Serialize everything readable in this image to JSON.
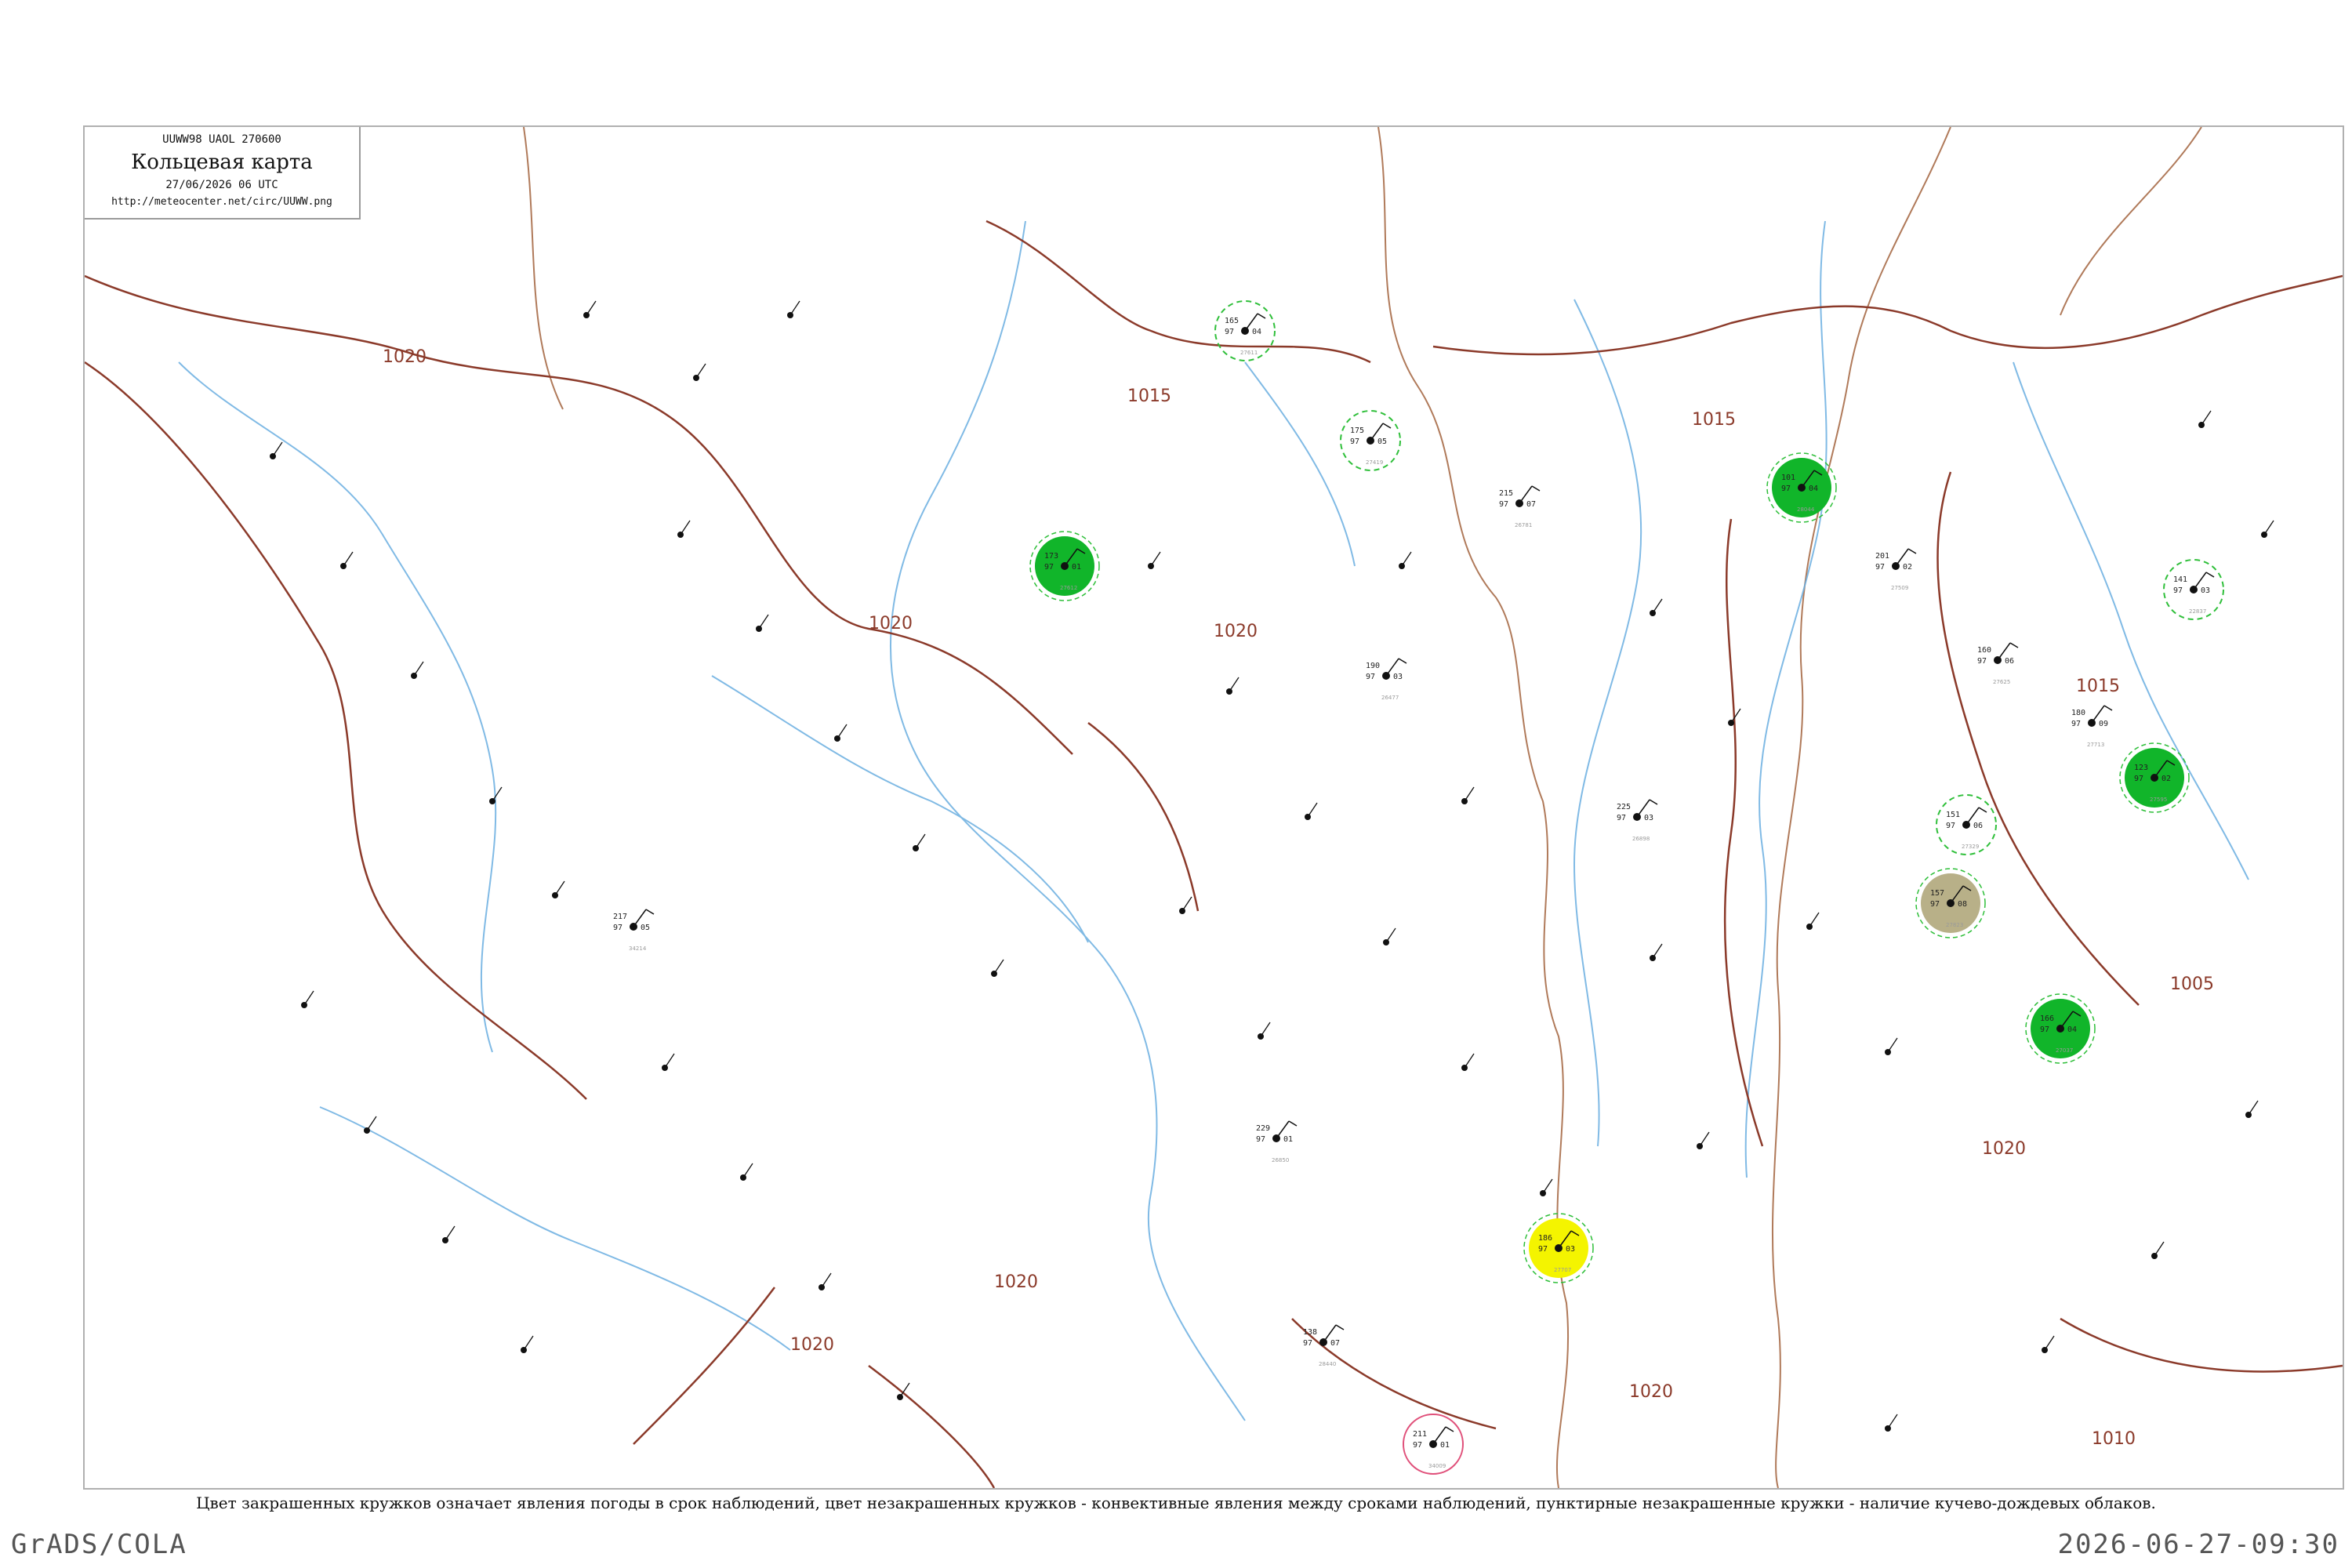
{
  "header": {
    "code": "UUWW98 UAOL 270600",
    "title": "Кольцевая карта",
    "datetime": "27/06/2026 06 UTC",
    "url": "http://meteocenter.net/circ/UUWW.png"
  },
  "caption": "Цвет закрашенных кружков означает явления погоды в срок наблюдений, цвет незакрашенных кружков - конвективные явления между сроками наблюдений, пунктирные незакрашенные кружки - наличие кучево-дождевых облаков.",
  "footer": {
    "software": "GrADS/COLA",
    "timestamp": "2026-06-27-09:30"
  },
  "colors": {
    "isobar": "#8b3a2a",
    "river": "#6aaee0",
    "rain_fill": "#11b52a",
    "cb_ring": "#2fbf3a",
    "fog_fill": "#f4f400",
    "haze_fill": "#b8b088",
    "shower_fill": "#5fe0c8",
    "thunder_ring": "#e0507a"
  },
  "isobar_labels": [
    "1020",
    "1015",
    "1010",
    "1005"
  ],
  "stations": [
    {
      "id": "27612",
      "top": "173",
      "temp": "97",
      "pres": "01",
      "wx": "rain"
    },
    {
      "id": "27611",
      "top": "165",
      "temp": "97",
      "pres": "04",
      "wx": "cb"
    },
    {
      "id": "27625",
      "top": "160",
      "temp": "97",
      "pres": "06",
      "wx": "none"
    },
    {
      "id": "26898",
      "top": "225",
      "temp": "97",
      "pres": "03",
      "wx": "none"
    },
    {
      "id": "27509",
      "top": "201",
      "temp": "97",
      "pres": "02",
      "wx": "none"
    },
    {
      "id": "27713",
      "top": "180",
      "temp": "97",
      "pres": "09",
      "wx": "none"
    },
    {
      "id": "26781",
      "top": "215",
      "temp": "97",
      "pres": "07",
      "wx": "none"
    },
    {
      "id": "27419",
      "top": "175",
      "temp": "97",
      "pres": "05",
      "wx": "cb"
    },
    {
      "id": "27707",
      "top": "186",
      "temp": "97",
      "pres": "03",
      "wx": "fog"
    },
    {
      "id": "27823",
      "top": "157",
      "temp": "97",
      "pres": "08",
      "wx": "haze"
    },
    {
      "id": "28044",
      "top": "101",
      "temp": "97",
      "pres": "04",
      "wx": "rain"
    },
    {
      "id": "22837",
      "top": "141",
      "temp": "97",
      "pres": "03",
      "wx": "cb"
    },
    {
      "id": "26477",
      "top": "190",
      "temp": "97",
      "pres": "03",
      "wx": "none"
    },
    {
      "id": "27037",
      "top": "166",
      "temp": "97",
      "pres": "04",
      "wx": "rain"
    },
    {
      "id": "26850",
      "top": "229",
      "temp": "97",
      "pres": "01",
      "wx": "none"
    },
    {
      "id": "27329",
      "top": "151",
      "temp": "97",
      "pres": "06",
      "wx": "cb"
    },
    {
      "id": "27595",
      "top": "123",
      "temp": "97",
      "pres": "02",
      "wx": "rain"
    },
    {
      "id": "28440",
      "top": "138",
      "temp": "97",
      "pres": "07",
      "wx": "none"
    },
    {
      "id": "34214",
      "top": "217",
      "temp": "97",
      "pres": "05",
      "wx": "none"
    },
    {
      "id": "34009",
      "top": "211",
      "temp": "97",
      "pres": "01",
      "wx": "thunder"
    }
  ]
}
